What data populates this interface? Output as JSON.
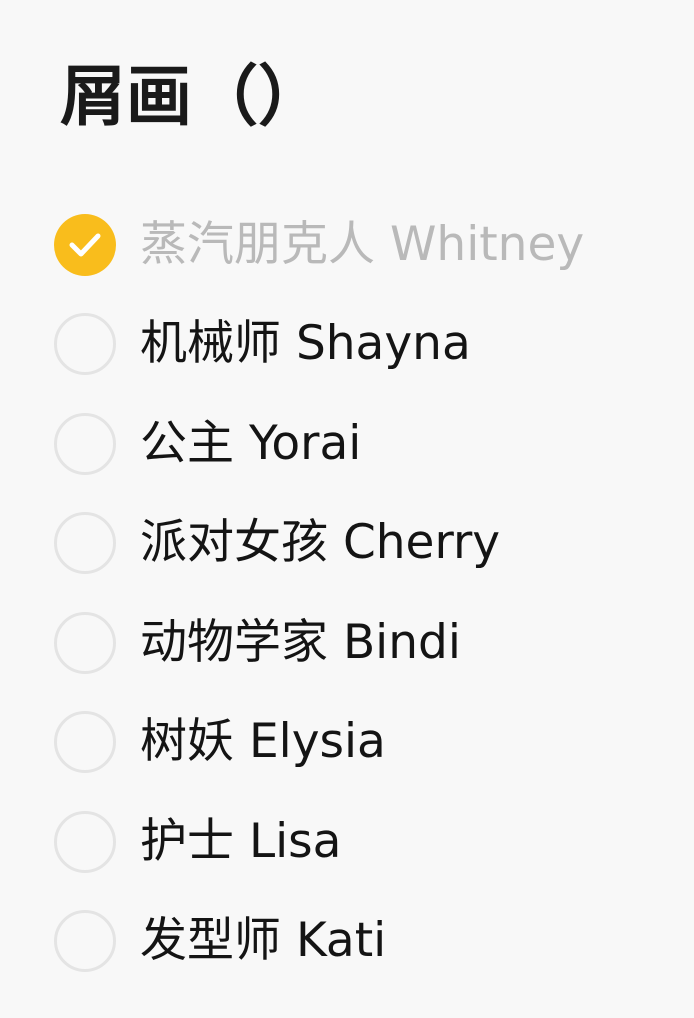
{
  "title": "屑画（）",
  "accent_color": "#f9bd1c",
  "items": [
    {
      "label": "蒸汽朋克人 Whitney",
      "checked": true
    },
    {
      "label": "机械师 Shayna",
      "checked": false
    },
    {
      "label": "公主 Yorai",
      "checked": false
    },
    {
      "label": "派对女孩 Cherry",
      "checked": false
    },
    {
      "label": "动物学家 Bindi",
      "checked": false
    },
    {
      "label": "树妖 Elysia",
      "checked": false
    },
    {
      "label": "护士 Lisa",
      "checked": false
    },
    {
      "label": "发型师 Kati",
      "checked": false
    }
  ]
}
